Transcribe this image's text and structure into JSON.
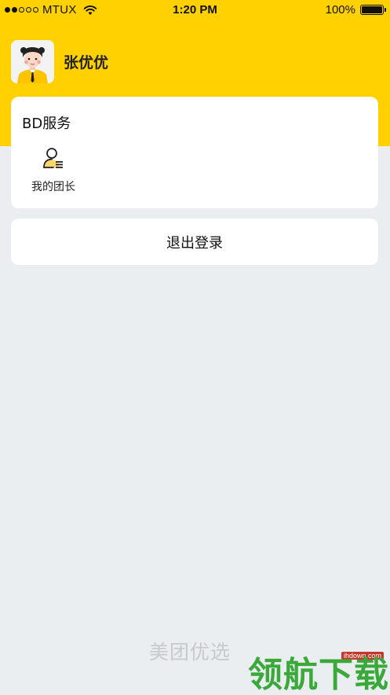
{
  "status_bar": {
    "carrier": "MTUX",
    "time": "1:20 PM",
    "battery": "100%",
    "signal_bars_filled": 2,
    "signal_bars_total": 5
  },
  "profile": {
    "name": "张优优"
  },
  "service_card": {
    "title": "BD服务",
    "items": [
      {
        "label": "我的团长",
        "icon": "team-leader-icon"
      }
    ]
  },
  "logout": {
    "label": "退出登录"
  },
  "footer": {
    "brand": "美团优选"
  },
  "watermark": {
    "url": "ihdown.com",
    "text": "领航下载"
  },
  "colors": {
    "header_yellow": "#ffd100",
    "page_background": "#ebeef1",
    "card_background": "#ffffff",
    "watermark_green": "#3aa93a"
  }
}
